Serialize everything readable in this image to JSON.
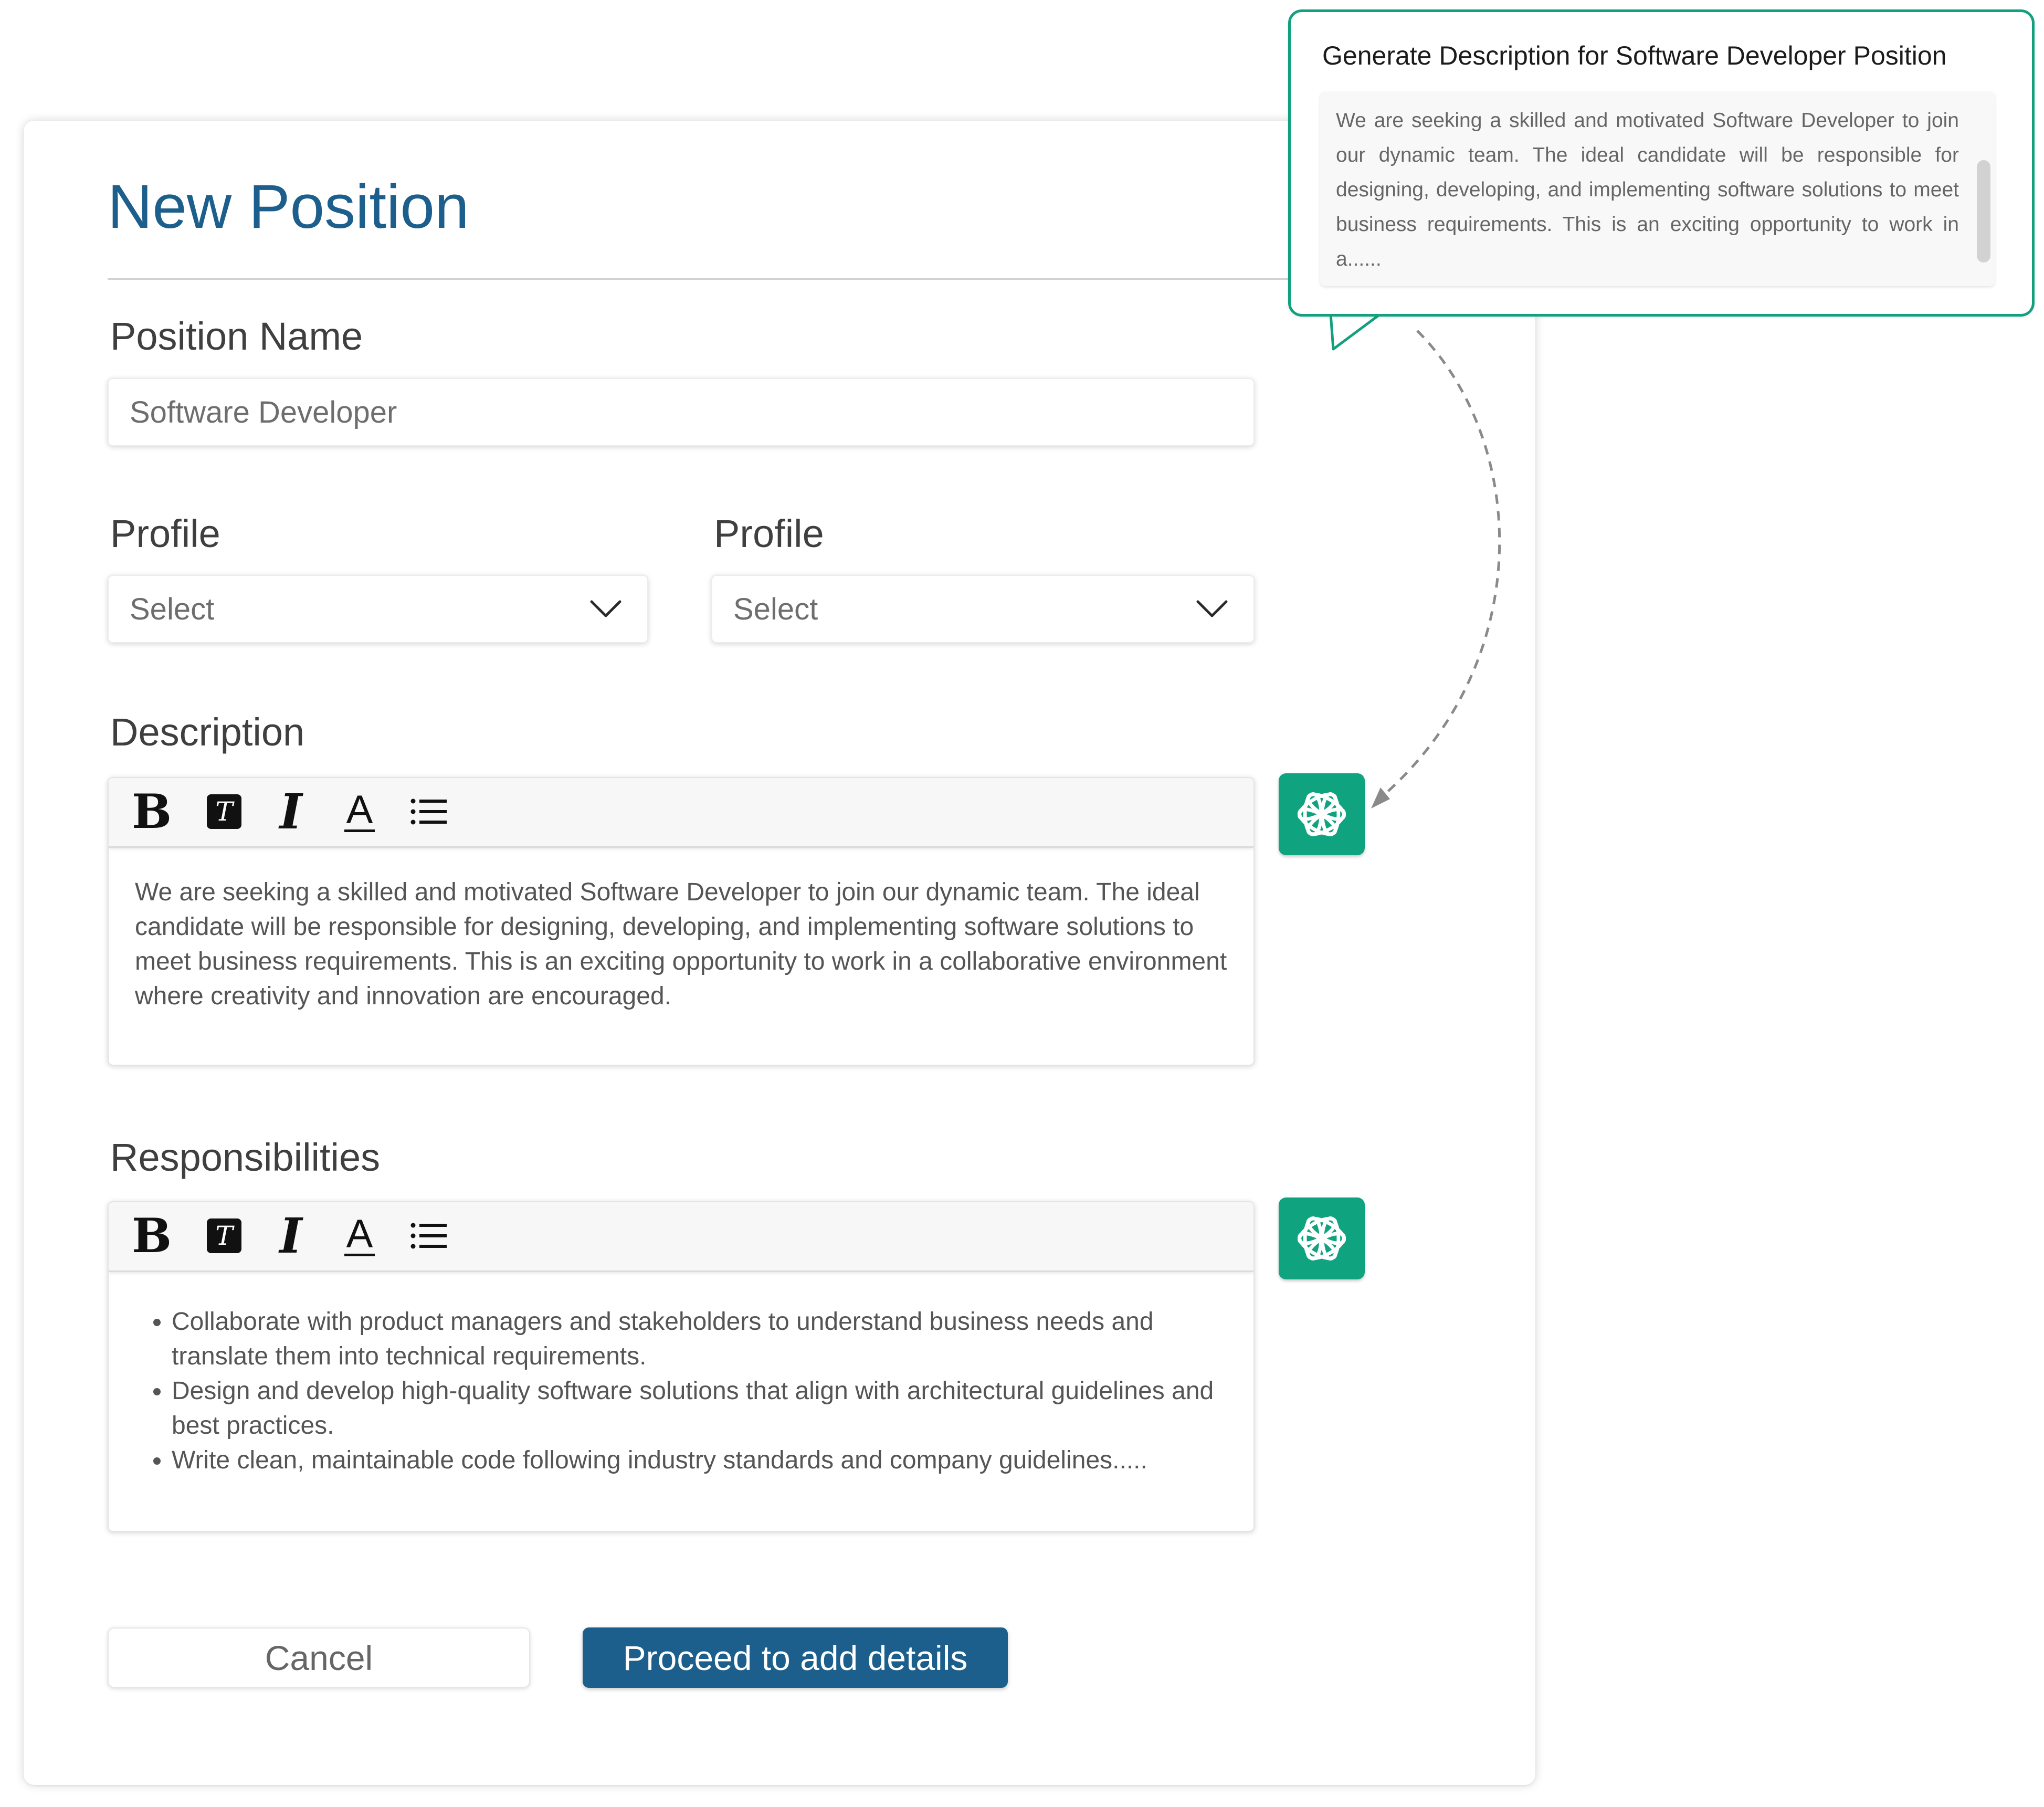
{
  "page": {
    "title": "New Position",
    "position_name": {
      "label": "Position Name",
      "value": "Software Developer"
    },
    "profile_left": {
      "label": "Profile",
      "value": "Select"
    },
    "profile_right": {
      "label": "Profile",
      "value": "Select"
    },
    "description": {
      "label": "Description",
      "text": "We are seeking a skilled and motivated Software Developer to join our dynamic team. The ideal candidate will be responsible for designing, developing, and implementing software solutions to meet business requirements. This is an exciting opportunity to work in a collaborative environment where creativity and innovation are encouraged."
    },
    "responsibilities": {
      "label": "Responsibilities",
      "items": [
        "Collaborate with product managers and stakeholders to understand business needs and translate them into technical requirements.",
        "Design and develop high-quality software solutions that align with architectural guidelines and best practices.",
        "Write clean, maintainable code following industry standards and company guidelines....."
      ]
    },
    "buttons": {
      "cancel": "Cancel",
      "proceed": "Proceed to add details"
    }
  },
  "toolbar": {
    "bold": "B",
    "text_style": "T",
    "italic": "I",
    "font_color": "A"
  },
  "popup": {
    "title": "Generate Description for Software Developer Position",
    "preview": "We are seeking a skilled and motivated Software Developer to join our dynamic team. The ideal candidate will be responsible for designing, developing, and implementing software solutions to meet business requirements. This is an exciting opportunity to work in a......"
  },
  "icons": {
    "ai": "chatgpt-logo-icon",
    "dropdown": "chevron-down-icon",
    "list": "bulleted-list-icon"
  },
  "colors": {
    "brand": "#1d5f8c",
    "ai_green": "#10a37f",
    "popup_border": "#12a07f"
  }
}
